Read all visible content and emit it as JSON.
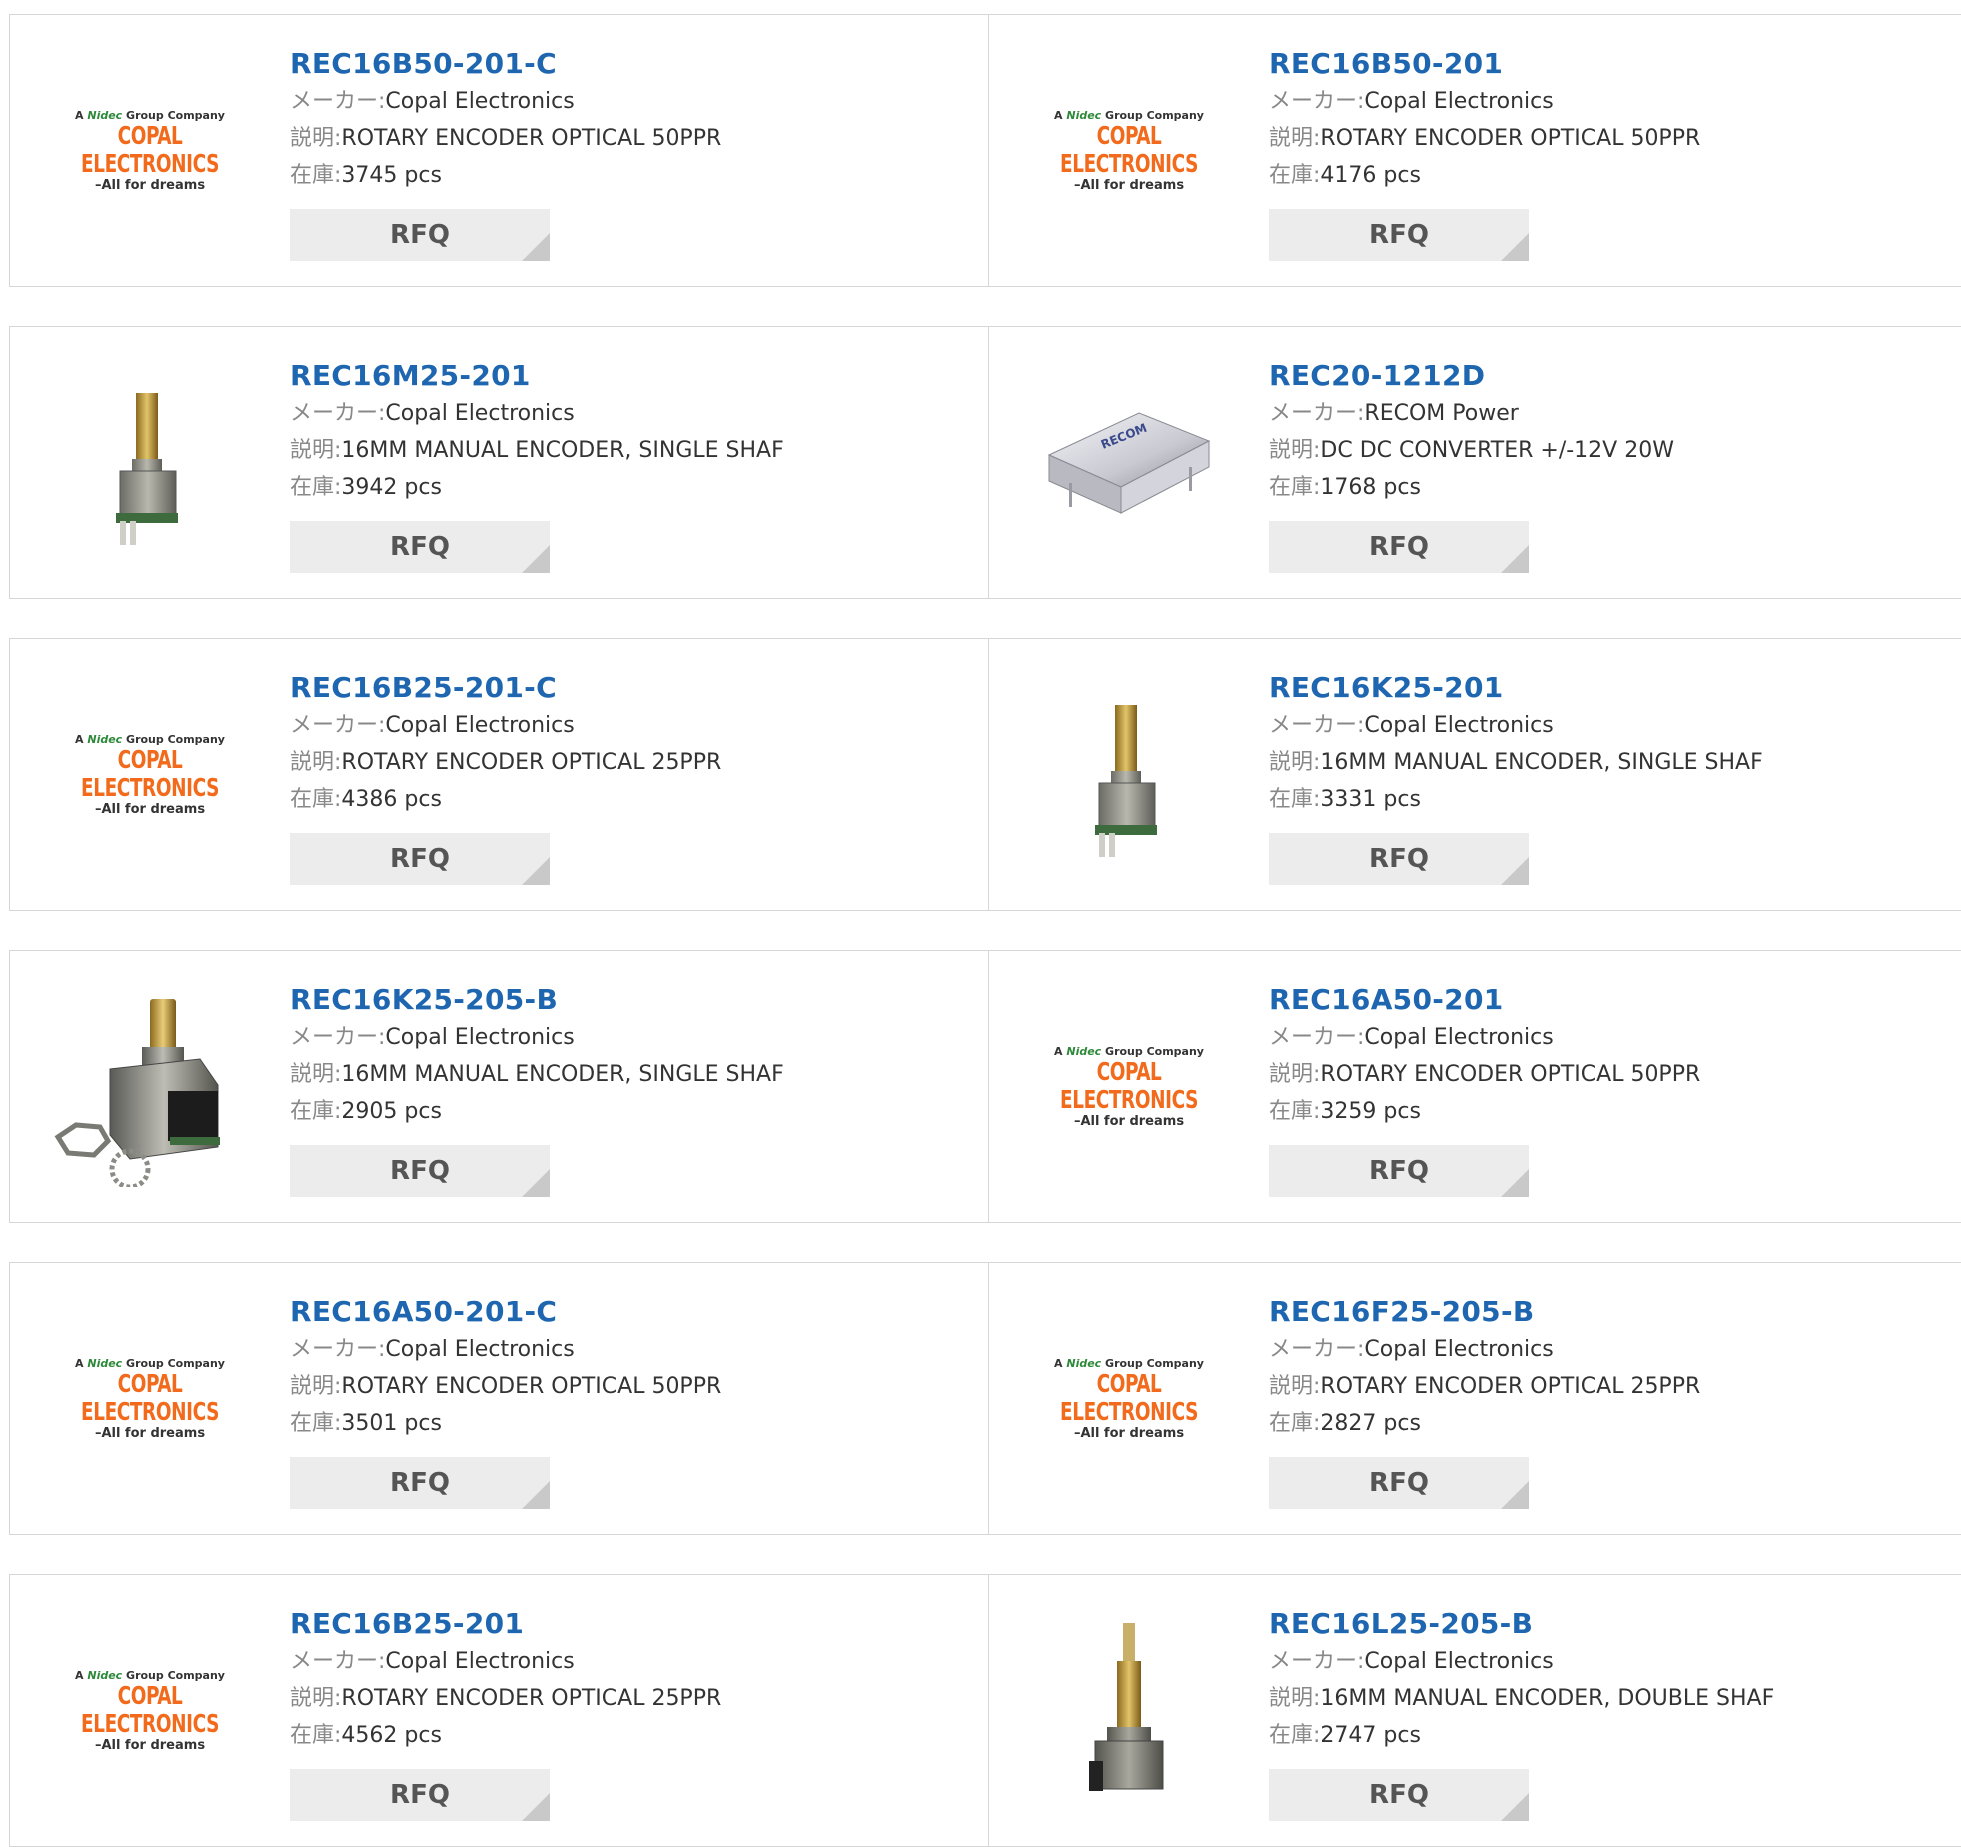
{
  "labels": {
    "maker": "メーカー:",
    "description": "説明:",
    "stock": "在庫:",
    "rfq": "RFQ"
  },
  "logo": {
    "line1_prefix": "A",
    "line1_brand": "Nidec",
    "line1_suffix": "Group Company",
    "line2": "COPAL ELECTRONICS",
    "line3": "–All for dreams"
  },
  "products": [
    {
      "part": "REC16B50-201-C",
      "maker": "Copal Electronics",
      "description": "ROTARY ENCODER OPTICAL 50PPR",
      "stock": "3745 pcs",
      "image": "copal-logo"
    },
    {
      "part": "REC16B50-201",
      "maker": "Copal Electronics",
      "description": "ROTARY ENCODER OPTICAL 50PPR",
      "stock": "4176 pcs",
      "image": "copal-logo"
    },
    {
      "part": "REC16M25-201",
      "maker": "Copal Electronics",
      "description": "16MM MANUAL ENCODER, SINGLE SHAF",
      "stock": "3942 pcs",
      "image": "encoder-single-shaft"
    },
    {
      "part": "REC20-1212D",
      "maker": "RECOM Power",
      "description": "DC DC CONVERTER +/-12V 20W",
      "stock": "1768 pcs",
      "image": "dc-converter-module"
    },
    {
      "part": "REC16B25-201-C",
      "maker": "Copal Electronics",
      "description": "ROTARY ENCODER OPTICAL 25PPR",
      "stock": "4386 pcs",
      "image": "copal-logo"
    },
    {
      "part": "REC16K25-201",
      "maker": "Copal Electronics",
      "description": "16MM MANUAL ENCODER, SINGLE SHAF",
      "stock": "3331 pcs",
      "image": "encoder-single-shaft"
    },
    {
      "part": "REC16K25-205-B",
      "maker": "Copal Electronics",
      "description": "16MM MANUAL ENCODER, SINGLE SHAF",
      "stock": "2905 pcs",
      "image": "encoder-with-nut"
    },
    {
      "part": "REC16A50-201",
      "maker": "Copal Electronics",
      "description": "ROTARY ENCODER OPTICAL 50PPR",
      "stock": "3259 pcs",
      "image": "copal-logo"
    },
    {
      "part": "REC16A50-201-C",
      "maker": "Copal Electronics",
      "description": "ROTARY ENCODER OPTICAL 50PPR",
      "stock": "3501 pcs",
      "image": "copal-logo"
    },
    {
      "part": "REC16F25-205-B",
      "maker": "Copal Electronics",
      "description": "ROTARY ENCODER OPTICAL 25PPR",
      "stock": "2827 pcs",
      "image": "copal-logo"
    },
    {
      "part": "REC16B25-201",
      "maker": "Copal Electronics",
      "description": "ROTARY ENCODER OPTICAL 25PPR",
      "stock": "4562 pcs",
      "image": "copal-logo"
    },
    {
      "part": "REC16L25-205-B",
      "maker": "Copal Electronics",
      "description": "16MM MANUAL ENCODER, DOUBLE SHAF",
      "stock": "2747 pcs",
      "image": "encoder-double-shaft"
    }
  ],
  "colors": {
    "link": "#1e66b0",
    "border": "#d6d6d6",
    "rfq_bg": "#ececec",
    "logo_orange": "#f26a1b",
    "logo_green": "#2e8a3a"
  }
}
